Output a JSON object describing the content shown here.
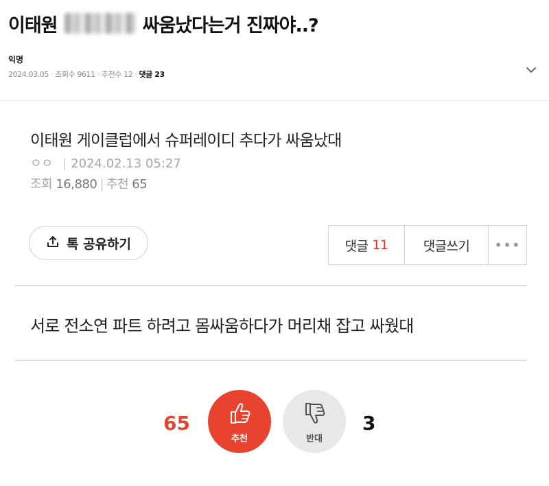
{
  "post": {
    "title_prefix": "이태원",
    "title_suffix": "싸움났다는거 진짜야..?",
    "author": "익명",
    "date": "2024.03.05",
    "views": "조회수 9611",
    "recommends": "추천수 12",
    "comments": "댓글 23"
  },
  "embedded": {
    "title": "이태원 게이클럽에서 슈퍼레이디 추다가 싸움났대",
    "author": "ㅇㅇ",
    "datetime": "2024.02.13 05:27",
    "views_label": "조회",
    "views": "16,880",
    "rec_label": "추천",
    "rec": "65",
    "share_label": "톡 공유하기",
    "comment_label": "댓글",
    "comment_count": "11",
    "write_comment_label": "댓글쓰기",
    "more_label": "•••",
    "body": "서로 전소연 파트 하려고 몸싸움하다가 머리채 잡고 싸웠대",
    "upvote_count": "65",
    "upvote_label": "추천",
    "downvote_label": "반대",
    "downvote_count": "3"
  },
  "colors": {
    "accent_red": "#e8432f",
    "count_red": "#d94a2f",
    "comment_count_red": "#d33a2c"
  },
  "icons": [
    "chevron-down-icon",
    "share-icon",
    "thumbs-up-icon",
    "thumbs-down-icon"
  ]
}
